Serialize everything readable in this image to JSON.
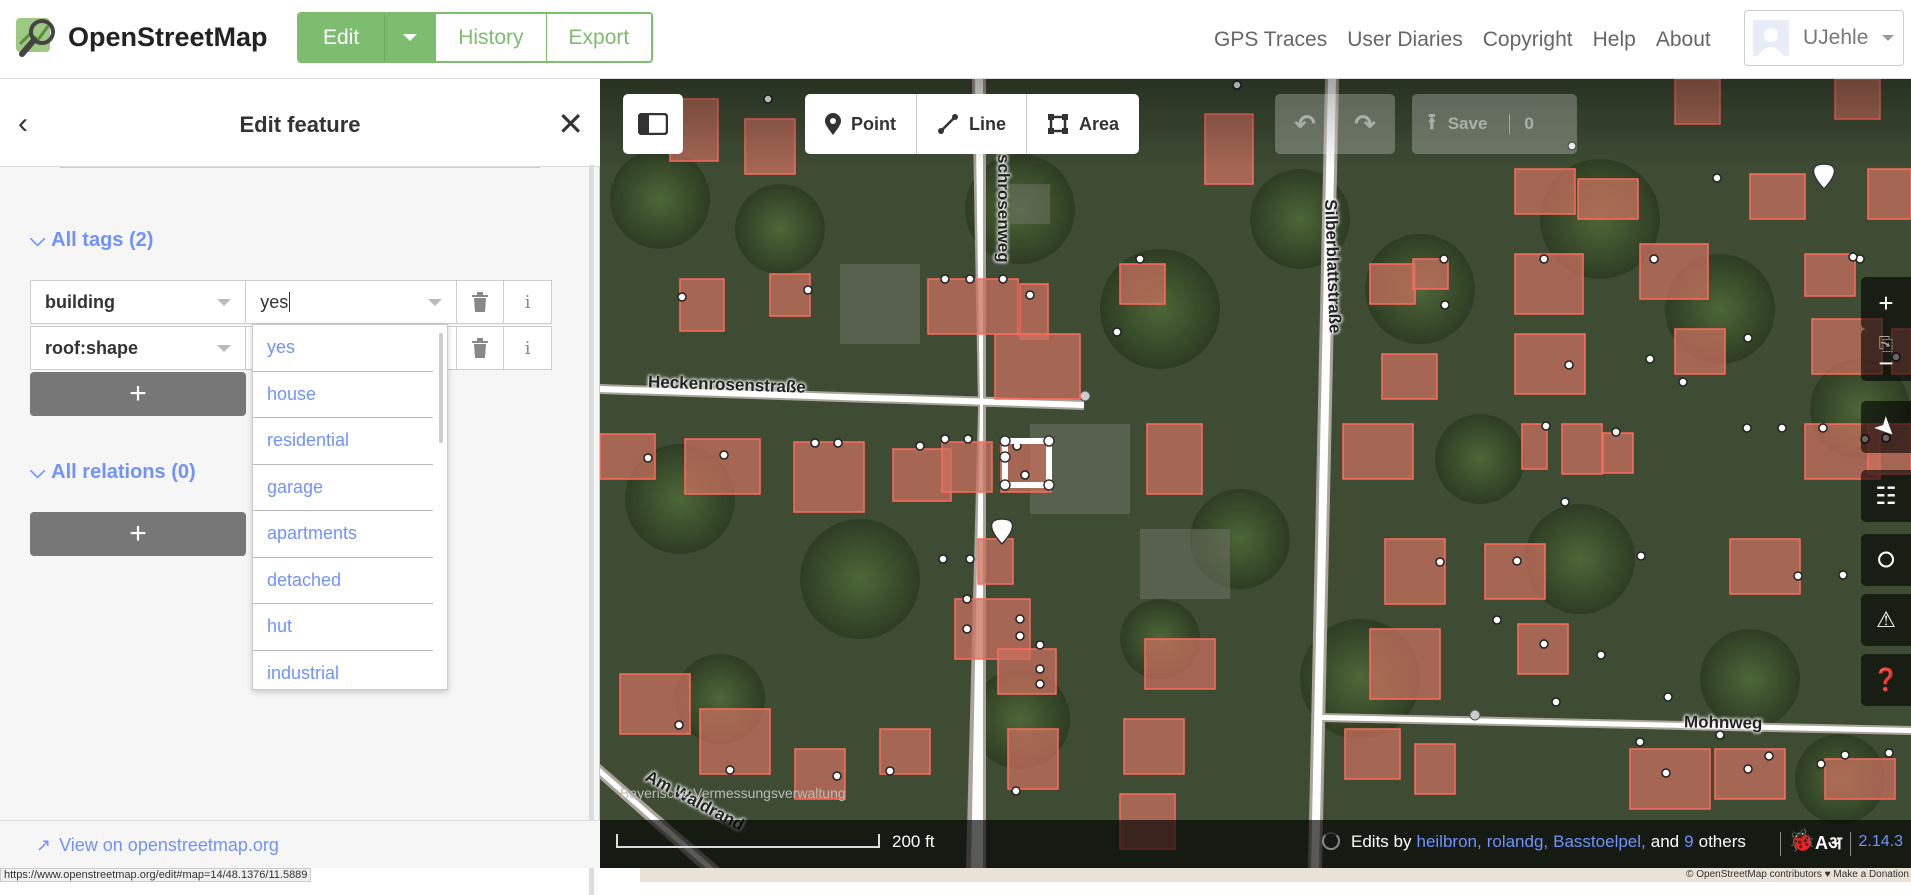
{
  "header": {
    "brand": "OpenStreetMap",
    "edit_label": "Edit",
    "history_label": "History",
    "export_label": "Export",
    "nav": [
      "GPS Traces",
      "User Diaries",
      "Copyright",
      "Help",
      "About"
    ],
    "username": "UJehle"
  },
  "sidebar": {
    "title": "Edit feature",
    "tags_section": "All tags (2)",
    "relations_section": "All relations (0)",
    "tags": [
      {
        "key": "building",
        "value": "yes"
      },
      {
        "key": "roof:shape",
        "value": ""
      }
    ],
    "add_label": "+",
    "dropdown_options": [
      "yes",
      "house",
      "residential",
      "garage",
      "apartments",
      "detached",
      "hut",
      "industrial"
    ],
    "footer_link": "View on openstreetmap.org"
  },
  "status_url": "https://www.openstreetmap.org/edit#map=14/48.1376/11.5889",
  "map": {
    "modes": [
      "Point",
      "Line",
      "Area"
    ],
    "save_label": "Save",
    "save_count": "0",
    "streets": {
      "heckenrosen": "Heckenrosenstraße",
      "schrosenweg": "schrosenweg",
      "silberblatt": "Silberblattstraße",
      "mohnweg": "Mohnweg",
      "am_waldrand": "Am Waldrand"
    },
    "imagery_credit": "Bayerische Vermessungsverwaltung",
    "scale_label": "200 ft",
    "attribution": {
      "prefix": "Edits by",
      "users": [
        "heilbron,",
        "rolandg,",
        "Basstoelpel,"
      ],
      "and": "and",
      "others_count": "9",
      "others": "others"
    },
    "version": "2.14.3",
    "osm_contrib": "© OpenStreetMap contributors ♥ Make a Donation"
  },
  "colors": {
    "accent": "#7ebc6f",
    "link": "#7092ff",
    "building": "#c8705f"
  }
}
